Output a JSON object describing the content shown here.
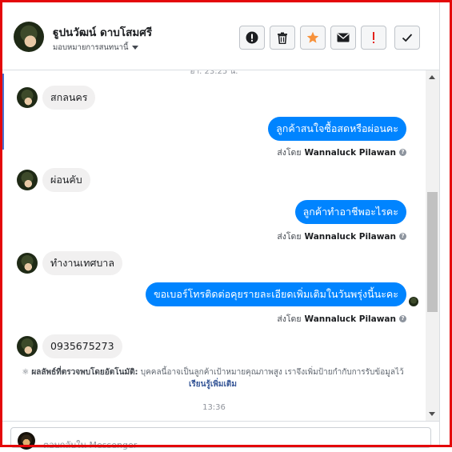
{
  "header": {
    "contact_name": "ฐูปนวัฒน์ ดาบโสมศรี",
    "assign_label": "มอบหมายการสนทนานี้",
    "actions": [
      {
        "icon": "info-circle-icon",
        "color": "#1c1e21"
      },
      {
        "icon": "trash-icon",
        "color": "#1c1e21"
      },
      {
        "icon": "star-icon",
        "color": "#f7923b"
      },
      {
        "icon": "envelope-icon",
        "color": "#1c1e21"
      },
      {
        "icon": "exclamation-icon",
        "color": "#e4221b"
      },
      {
        "icon": "check-icon",
        "color": "#1c1e21"
      }
    ]
  },
  "conversation": {
    "top_timestamp": "อา. 23:25 น.",
    "messages": [
      {
        "direction": "in",
        "text": "สกลนคร"
      },
      {
        "direction": "out",
        "text": "ลูกค้าสนใจซื้อสดหรือผ่อนคะ",
        "sent_by_prefix": "ส่งโดย",
        "sent_by": "Wannaluck Pilawan"
      },
      {
        "direction": "in",
        "text": "ผ่อนคับ"
      },
      {
        "direction": "out",
        "text": "ลูกค้าทำอาชีพอะไรคะ",
        "sent_by_prefix": "ส่งโดย",
        "sent_by": "Wannaluck Pilawan"
      },
      {
        "direction": "in",
        "text": "ทำงานเทศบาล"
      },
      {
        "direction": "out",
        "text": "ขอเบอร์โทรติดต่อคุยรายละเอียดเพิ่มเติมในวันพรุ่งนี้นะคะ",
        "sent_by_prefix": "ส่งโดย",
        "sent_by": "Wannaluck Pilawan"
      },
      {
        "direction": "in",
        "text": "0935675273"
      }
    ],
    "auto_detect": {
      "label": "ผลลัพธ์ที่ตรวจพบโดยอัตโนมัติ:",
      "text": "บุคคลนี้อาจเป็นลูกค้าเป้าหมายคุณภาพสูง เราจึงเพิ่มป้ายกำกับการรับข้อมูลไว้",
      "link": "เรียนรู้เพิ่มเติม"
    },
    "bottom_timestamp": "13:36"
  },
  "composer": {
    "placeholder": "ตอบกลับใน Messenger"
  }
}
